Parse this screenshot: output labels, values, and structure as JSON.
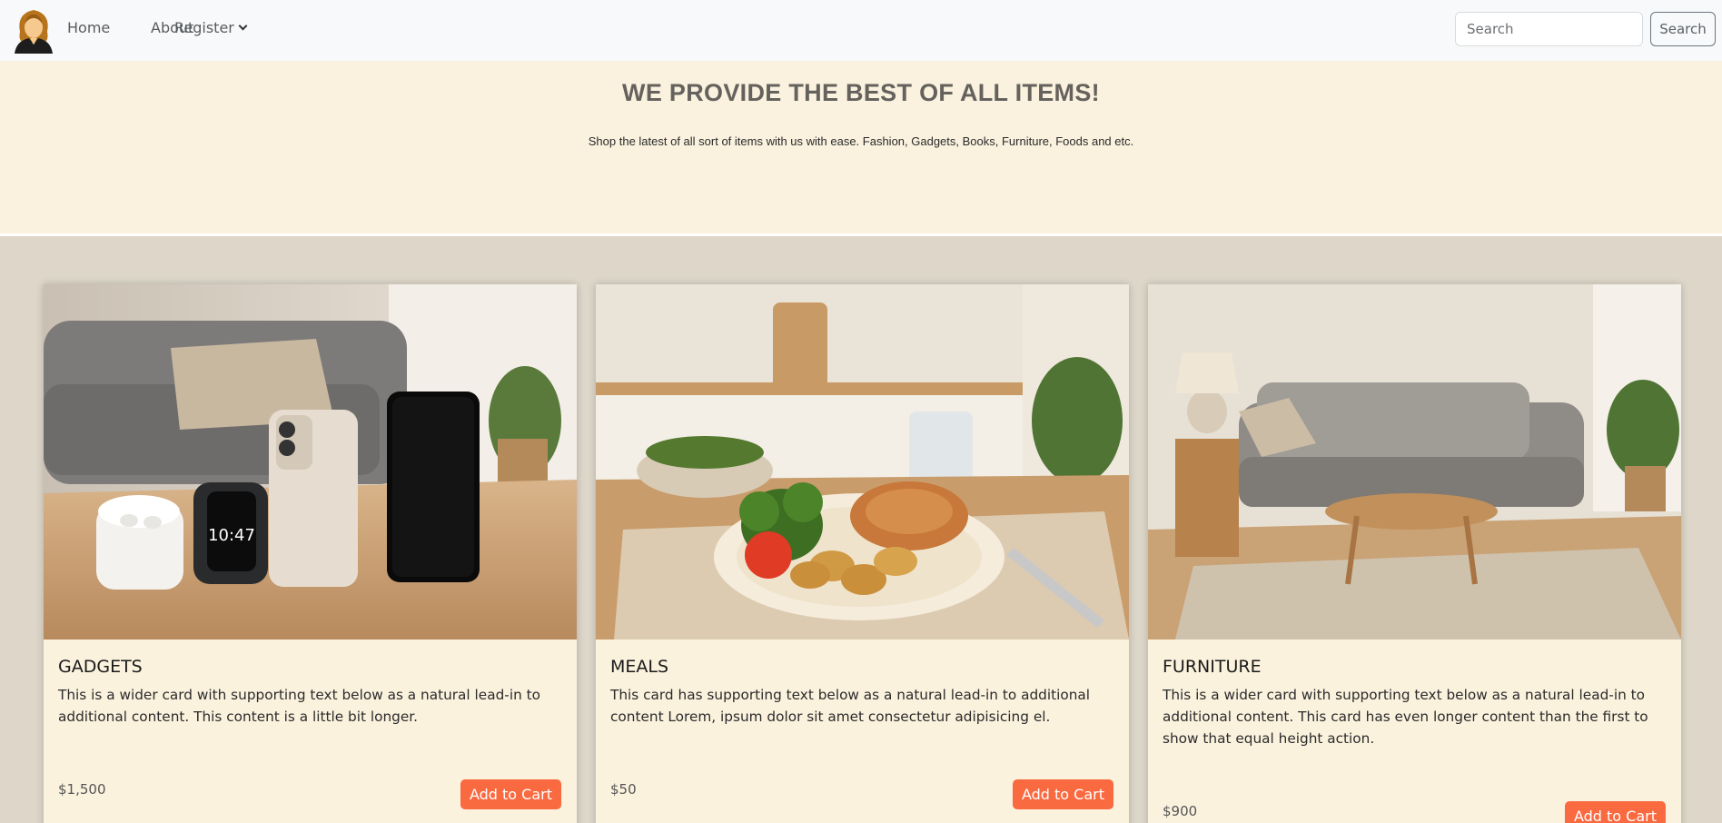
{
  "nav": {
    "links": [
      "Home",
      "About",
      "Register"
    ],
    "search_placeholder": "Search",
    "search_button": "Search"
  },
  "hero": {
    "title": "WE PROVIDE THE BEST OF ALL ITEMS!",
    "subtitle": "Shop the latest of all sort of items with us with ease. Fashion, Gadgets, Books, Furniture, Foods and etc."
  },
  "cards": [
    {
      "title": "GADGETS",
      "text": "This is a wider card with supporting text below as a natural lead-in to additional content. This content is a little bit longer.",
      "price": "$1,500",
      "button": "Add to Cart"
    },
    {
      "title": "MEALS",
      "text": "This card has supporting text below as a natural lead-in to additional content Lorem, ipsum dolor sit amet consectetur adipisicing el.",
      "price": "$50",
      "button": "Add to Cart"
    },
    {
      "title": "FURNITURE",
      "text": "This is a wider card with supporting text below as a natural lead-in to additional content. This card has even longer content than the first to show that equal height action.",
      "price": "$900",
      "button": "Add to Cart"
    }
  ],
  "watch_time": "10:47"
}
